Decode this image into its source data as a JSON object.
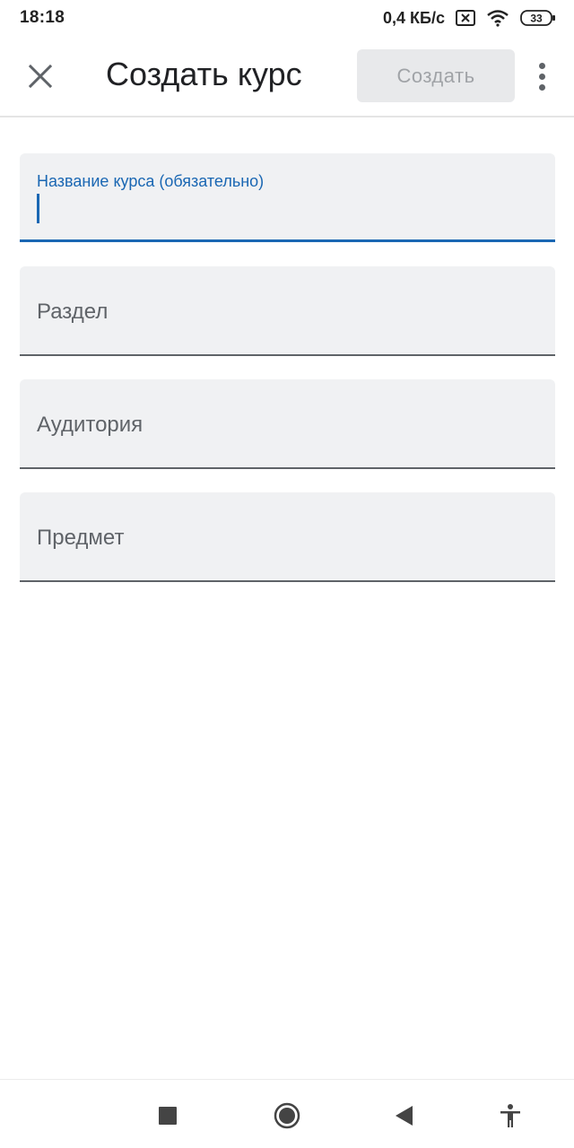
{
  "status_bar": {
    "time": "18:18",
    "network_speed": "0,4 КБ/с",
    "battery_level": "33",
    "icons": [
      "sim-x-icon",
      "wifi-icon",
      "battery-icon"
    ]
  },
  "app_bar": {
    "close_icon": "close-icon",
    "title": "Создать курс",
    "create_button_label": "Создать",
    "more_icon": "more-vert-icon"
  },
  "form": {
    "course_name": {
      "label": "Название курса (обязательно)",
      "value": ""
    },
    "section": {
      "placeholder": "Раздел",
      "value": ""
    },
    "room": {
      "placeholder": "Аудитория",
      "value": ""
    },
    "subject": {
      "placeholder": "Предмет",
      "value": ""
    }
  },
  "nav_bar": {
    "icons": [
      "recents-square-icon",
      "home-circle-icon",
      "back-triangle-icon",
      "accessibility-icon"
    ]
  },
  "colors": {
    "accent": "#1a67b3",
    "field_background": "#f0f1f3",
    "disabled_button_bg": "#e8e9eb",
    "disabled_button_text": "#a0a3a7"
  }
}
